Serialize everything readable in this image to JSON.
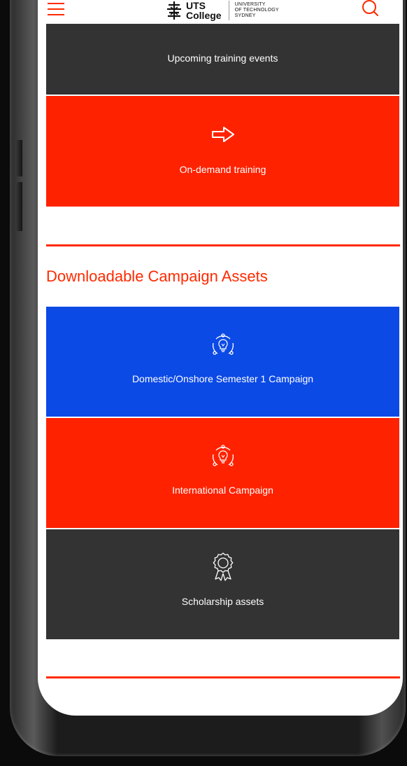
{
  "header": {
    "logo_line1": "UTS",
    "logo_line2": "College",
    "uni_line1": "UNIVERSITY",
    "uni_line2": "OF TECHNOLOGY",
    "uni_line3": "SYDNEY",
    "menu_icon": "hamburger-icon",
    "search_icon": "search-icon"
  },
  "tiles_top": [
    {
      "label": "Upcoming training events",
      "color": "#333333"
    },
    {
      "label": "On-demand training",
      "color": "#ff2200",
      "icon": "arrow-right-icon"
    }
  ],
  "section": {
    "heading": "Downloadable Campaign Assets"
  },
  "campaign_tiles": [
    {
      "label": "Domestic/Onshore Semester 1 Campaign",
      "color": "#0c4ae6",
      "icon": "lightbulb-icon"
    },
    {
      "label": "International Campaign",
      "color": "#ff2200",
      "icon": "lightbulb-icon"
    },
    {
      "label": "Scholarship assets",
      "color": "#333333",
      "icon": "award-icon"
    }
  ],
  "colors": {
    "accent": "#ff2a00",
    "blue": "#0c4ae6",
    "dark": "#333333"
  }
}
